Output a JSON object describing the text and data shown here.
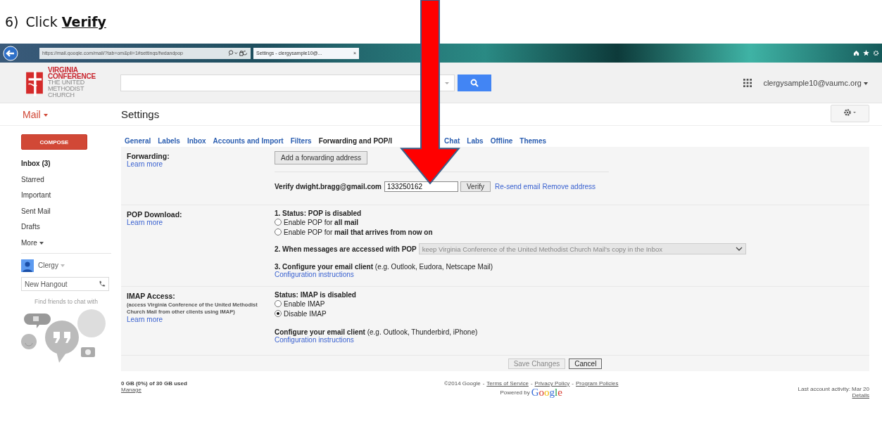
{
  "instruction": {
    "number": "6)",
    "text": "Click **Verify**"
  },
  "browser": {
    "url": "https://mail.google.com/mail/?tab=om&pli=1#settings/fwdandpop",
    "tab_title": "Settings - clergysample10@...",
    "tab_close": "×"
  },
  "logo": {
    "lines": [
      "VIRGINIA",
      "CONFERENCE",
      "THE UNITED",
      "METHODIST",
      "CHURCH"
    ]
  },
  "account": "clergysample10@vaumc.org",
  "app_name": "Mail",
  "page_title": "Settings",
  "sidebar": {
    "compose": "COMPOSE",
    "items": [
      {
        "label": "Inbox (3)",
        "unread": true,
        "kind": "folder"
      },
      {
        "label": "Starred",
        "unread": false,
        "kind": "folder"
      },
      {
        "label": "Important",
        "unread": false,
        "kind": "folder"
      },
      {
        "label": "Sent Mail",
        "unread": false,
        "kind": "folder"
      },
      {
        "label": "Drafts",
        "unread": false,
        "kind": "folder"
      },
      {
        "label": "More",
        "unread": false,
        "kind": "more"
      }
    ],
    "chat_user": "Clergy",
    "hangout_placeholder": "New Hangout",
    "find_friends": "Find friends to chat with"
  },
  "tabs": [
    {
      "label": "General",
      "selected": false
    },
    {
      "label": "Labels",
      "selected": false
    },
    {
      "label": "Inbox",
      "selected": false
    },
    {
      "label": "Accounts and Import",
      "selected": false
    },
    {
      "label": "Filters",
      "selected": false
    },
    {
      "label": "Forwarding and POP/I",
      "selected": true
    },
    {
      "label": "Chat",
      "selected": false
    },
    {
      "label": "Labs",
      "selected": false
    },
    {
      "label": "Offline",
      "selected": false
    },
    {
      "label": "Themes",
      "selected": false
    }
  ],
  "forwarding": {
    "label": "Forwarding:",
    "learn_more": "Learn more",
    "add_button": "Add a forwarding address",
    "verify_label": "Verify dwight.bragg@gmail.com",
    "code_value": "133250162",
    "verify_button": "Verify",
    "resend": "Re-send email",
    "remove": "Remove address"
  },
  "pop": {
    "label": "POP Download:",
    "learn_more": "Learn more",
    "status": "1. Status: POP is disabled",
    "options": [
      {
        "text": "Enable POP for **all mail**",
        "selected": false
      },
      {
        "text": "Enable POP for **mail that arrives from now on**",
        "selected": false
      }
    ],
    "step2_label": "2. When messages are accessed with POP",
    "step2_value": "keep Virginia Conference of the United Methodist Church Mail's copy in the Inbox",
    "step3": "**3. Configure your email client** (e.g. Outlook, Eudora, Netscape Mail)",
    "config_link": "Configuration instructions"
  },
  "imap": {
    "label": "IMAP Access:",
    "note": "(access Virginia Conference of the United Methodist Church Mail from other clients using IMAP)",
    "learn_more": "Learn more",
    "status": "Status: IMAP is disabled",
    "options": [
      {
        "text": "Enable IMAP",
        "selected": false
      },
      {
        "text": "Disable IMAP",
        "selected": true
      }
    ],
    "configure": "**Configure your email client** (e.g. Outlook, Thunderbird, iPhone)",
    "config_link": "Configuration instructions"
  },
  "actions": [
    {
      "label": "Save Changes",
      "disabled": true
    },
    {
      "label": "Cancel",
      "disabled": false
    }
  ],
  "footer": {
    "storage": "0 GB (0%) of 30 GB used",
    "manage": "Manage",
    "copyright": "©2014 Google",
    "separator": "-",
    "links": [
      "Terms of Service",
      "Privacy Policy",
      "Program Policies"
    ],
    "powered_by": "Powered by",
    "google": "Google",
    "last_activity": "Last account activity: Mar 20",
    "details": "Details"
  }
}
